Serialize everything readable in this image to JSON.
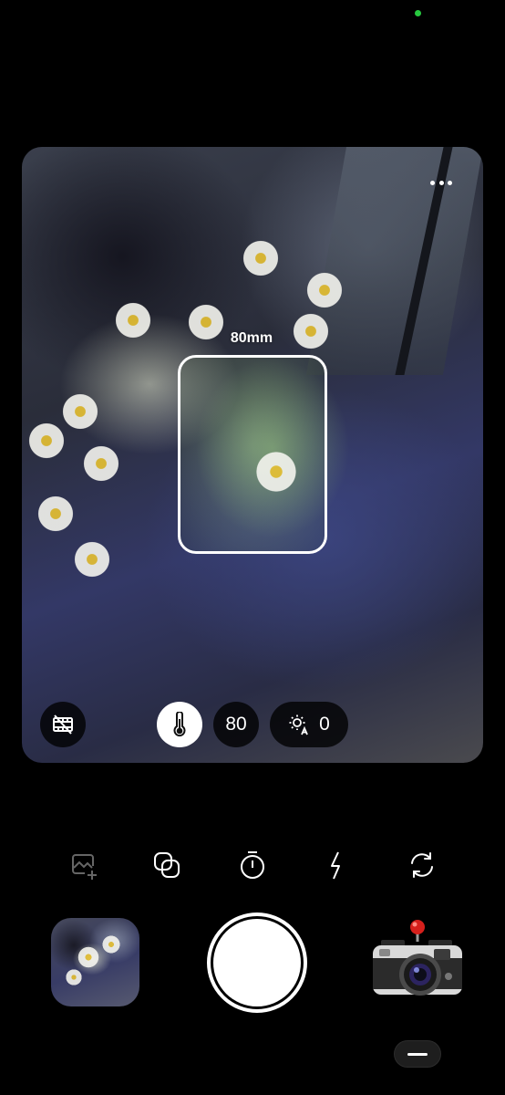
{
  "viewfinder": {
    "focal_label": "80mm",
    "focal_value": "80",
    "exposure_value": "0",
    "icons": [
      "more-icon",
      "film-off-icon",
      "temperature-icon",
      "exposure-auto-icon"
    ]
  },
  "toolbar": {
    "icons": [
      "gallery-add-icon",
      "overlay-icon",
      "timer-icon",
      "flash-icon",
      "flip-camera-icon"
    ]
  },
  "colors": {
    "status_dot": "#27c93f",
    "background": "#000000",
    "camera_button": "#d6201c"
  }
}
